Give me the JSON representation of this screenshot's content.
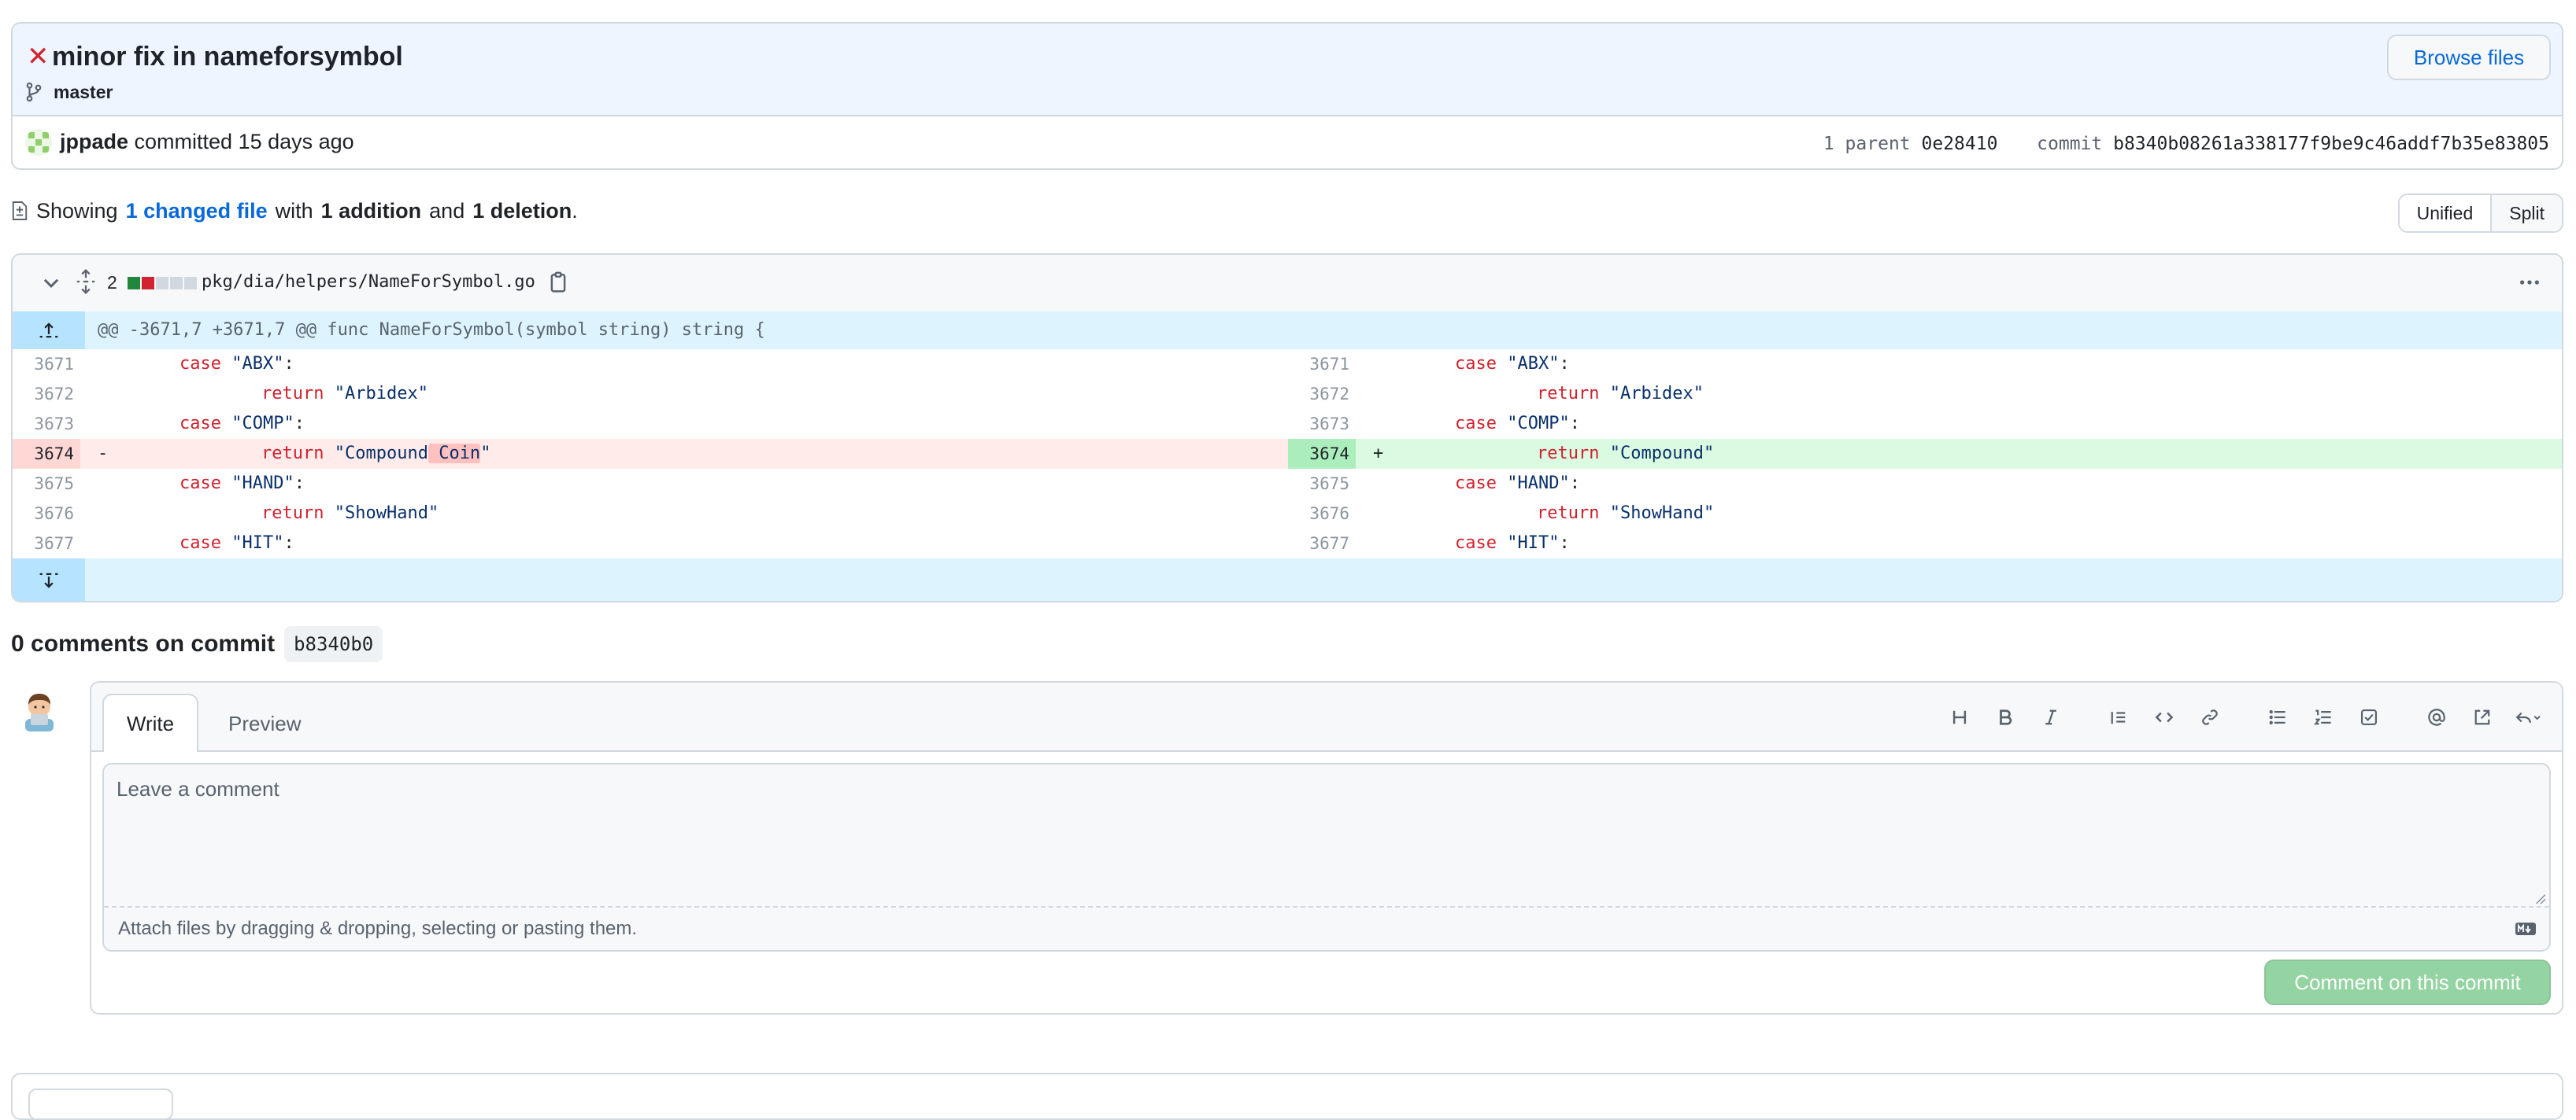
{
  "commit": {
    "fail_icon": "x-icon",
    "title": "minor fix in nameforsymbol",
    "branch": "master",
    "browse_files": "Browse files",
    "author": "jppade",
    "committed_text": "committed 15 days ago",
    "parent_label": "1 parent",
    "parent_hash": "0e28410",
    "commit_label": "commit",
    "commit_hash": "b8340b08261a338177f9be9c46addf7b35e83805"
  },
  "summary": {
    "showing": "Showing",
    "changed_files": "1 changed file",
    "with": "with",
    "additions": "1 addition",
    "and": "and",
    "deletions": "1 deletion",
    "period": "."
  },
  "view_toggle": {
    "unified": "Unified",
    "split": "Split",
    "selected": "Split"
  },
  "diff": {
    "change_count": "2",
    "file_path": "pkg/dia/helpers/NameForSymbol.go",
    "hunk_header": "@@ -3671,7 +3671,7 @@ func NameForSymbol(symbol string) string {",
    "left": [
      {
        "ln": "3671",
        "kw": "case",
        "str": "\"ABX\"",
        "tail": ":",
        "indent": 1
      },
      {
        "ln": "3672",
        "kw": "return",
        "str": "\"Arbidex\"",
        "tail": "",
        "indent": 2
      },
      {
        "ln": "3673",
        "kw": "case",
        "str": "\"COMP\"",
        "tail": ":",
        "indent": 1
      },
      {
        "ln": "3674",
        "sign": "-",
        "kw": "return",
        "str_a": "\"Compound",
        "str_hl": " Coin",
        "str_b": "\"",
        "indent": 2
      },
      {
        "ln": "3675",
        "kw": "case",
        "str": "\"HAND\"",
        "tail": ":",
        "indent": 1
      },
      {
        "ln": "3676",
        "kw": "return",
        "str": "\"ShowHand\"",
        "tail": "",
        "indent": 2
      },
      {
        "ln": "3677",
        "kw": "case",
        "str": "\"HIT\"",
        "tail": ":",
        "indent": 1
      }
    ],
    "right": [
      {
        "ln": "3671",
        "kw": "case",
        "str": "\"ABX\"",
        "tail": ":",
        "indent": 1
      },
      {
        "ln": "3672",
        "kw": "return",
        "str": "\"Arbidex\"",
        "tail": "",
        "indent": 2
      },
      {
        "ln": "3673",
        "kw": "case",
        "str": "\"COMP\"",
        "tail": ":",
        "indent": 1
      },
      {
        "ln": "3674",
        "sign": "+",
        "kw": "return",
        "str": "\"Compound\"",
        "tail": "",
        "indent": 2
      },
      {
        "ln": "3675",
        "kw": "case",
        "str": "\"HAND\"",
        "tail": ":",
        "indent": 1
      },
      {
        "ln": "3676",
        "kw": "return",
        "str": "\"ShowHand\"",
        "tail": "",
        "indent": 2
      },
      {
        "ln": "3677",
        "kw": "case",
        "str": "\"HIT\"",
        "tail": ":",
        "indent": 1
      }
    ]
  },
  "comments": {
    "heading": "0 comments on commit",
    "short_sha": "b8340b0",
    "tab_write": "Write",
    "tab_preview": "Preview",
    "placeholder": "Leave a comment",
    "attach_hint": "Attach files by dragging & dropping, selecting or pasting them.",
    "submit": "Comment on this commit"
  },
  "colors": {
    "accent": "#0969da",
    "danger": "#d1242f",
    "deletion_bg": "#ffebe9",
    "addition_bg": "#dafbe1",
    "submit_disabled": "#94d3a2"
  }
}
